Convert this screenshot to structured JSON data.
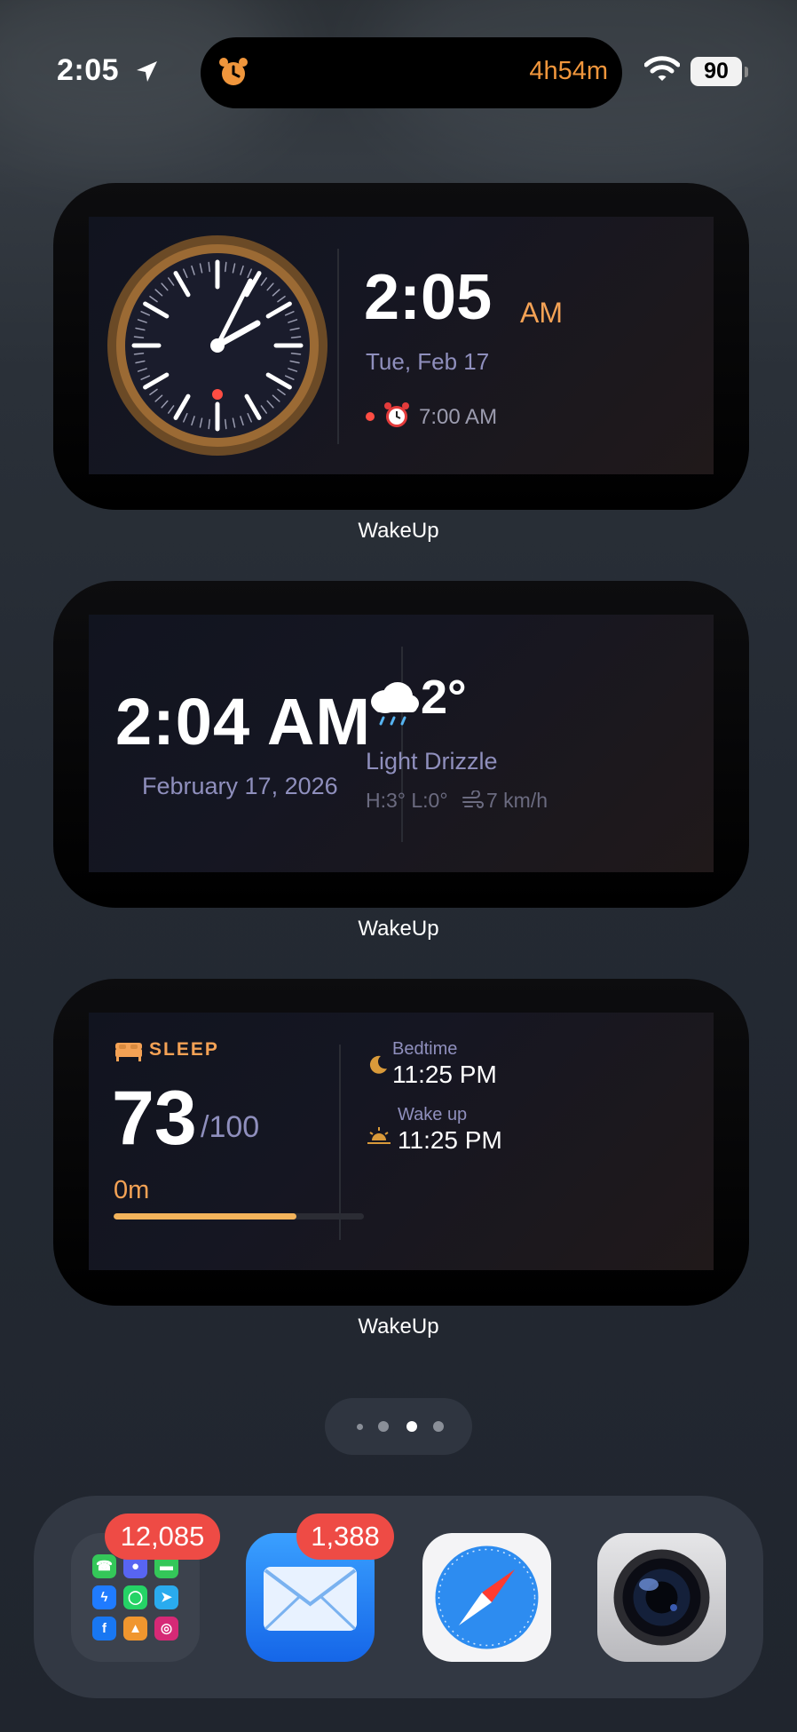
{
  "status_bar": {
    "time": "2:05",
    "battery": "90"
  },
  "dynamic_island": {
    "countdown": "4h54m"
  },
  "widgets": {
    "clock": {
      "label": "WakeUp",
      "time": "2:05",
      "ampm": "AM",
      "date": "Tue, Feb 17",
      "alarm_time": "7:00 AM"
    },
    "weather": {
      "label": "WakeUp",
      "time": "2:04 AM",
      "date": "February 17, 2026",
      "temperature": "2°",
      "condition": "Light Drizzle",
      "hilo": "H:3° L:0°",
      "wind": "7 km/h"
    },
    "sleep": {
      "label": "WakeUp",
      "title": "SLEEP",
      "score": "73",
      "score_max": "/100",
      "duration": "0m",
      "progress": 0.73,
      "bedtime_label": "Bedtime",
      "bedtime": "11:25 PM",
      "wakeup_label": "Wake up",
      "wakeup": "11:25 PM"
    }
  },
  "page_indicator": {
    "count": 4,
    "current": 3
  },
  "dock": {
    "folder_badge": "12,085",
    "mail_badge": "1,388",
    "icons": [
      "social-folder-icon",
      "mail-icon",
      "safari-icon",
      "camera-icon"
    ]
  },
  "colors": {
    "accent": "#f4a255",
    "badge": "#ee4b45",
    "alarm_dot": "#ff4d43"
  }
}
